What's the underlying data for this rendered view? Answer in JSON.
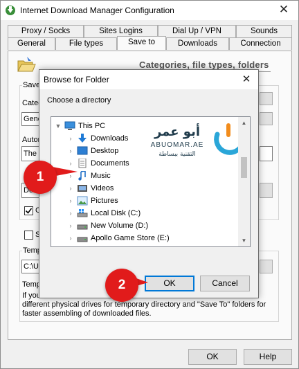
{
  "window": {
    "title": "Internet Download Manager Configuration"
  },
  "tabs_row1": [
    "Proxy / Socks",
    "Sites Logins",
    "Dial Up / VPN",
    "Sounds"
  ],
  "tabs_row2": [
    "General",
    "File types",
    "Save to",
    "Downloads",
    "Connection"
  ],
  "active_tab": "Save to",
  "panel": {
    "section_title": "Categories, file types, folders",
    "fragments": {
      "save_label": "Save",
      "category_label": "Categ",
      "general_value": "Gene",
      "auto_label": "Autor",
      "the_value": "The",
      "download_value": "Dow",
      "checkbox_c": "C",
      "checkbox_s": "S",
      "temp_label": "Temp",
      "temp_path": "C:\\U",
      "temp_label2": "Temp",
      "tip_prefix": "Tip:"
    },
    "note_lines": [
      "If you",
      "different physical drives for temporary directory and \"Save To\" folders for",
      "faster assembling of downloaded files."
    ]
  },
  "footer": {
    "ok": "OK",
    "help": "Help"
  },
  "dialog": {
    "title": "Browse for Folder",
    "prompt": "Choose a directory",
    "tree": [
      {
        "label": "This PC",
        "icon": "monitor-icon",
        "expanded": true,
        "level": 0,
        "selected": false
      },
      {
        "label": "Downloads",
        "icon": "download-arrow-icon",
        "level": 1
      },
      {
        "label": "Desktop",
        "icon": "desktop-icon",
        "level": 1
      },
      {
        "label": "Documents",
        "icon": "documents-icon",
        "level": 1
      },
      {
        "label": "Music",
        "icon": "music-note-icon",
        "level": 1
      },
      {
        "label": "Videos",
        "icon": "video-icon",
        "level": 1
      },
      {
        "label": "Pictures",
        "icon": "pictures-icon",
        "level": 1
      },
      {
        "label": "Local Disk (C:)",
        "icon": "windows-drive-icon",
        "level": 1
      },
      {
        "label": "New Volume (D:)",
        "icon": "drive-icon",
        "level": 1
      },
      {
        "label": "Apollo Game Store (E:)",
        "icon": "drive-icon",
        "level": 1
      }
    ],
    "ok": "OK",
    "cancel": "Cancel"
  },
  "watermark": {
    "arabic_name": "أبو عمر",
    "latin": "ABUOMAR.AE",
    "tagline": "التقنية ببساطة"
  },
  "annotations": {
    "badge1": "1",
    "badge2": "2"
  },
  "colors": {
    "accent": "#0078d7",
    "badge": "#e11b1b",
    "watermark_dark": "#1e3a4a",
    "watermark_blue": "#2aa6d8",
    "watermark_orange": "#f28c1c"
  }
}
